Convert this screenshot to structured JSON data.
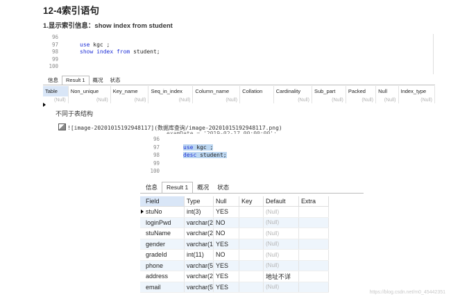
{
  "heading": "12-4索引语句",
  "subheading": "1.显示索引信息：show index from student",
  "editor1": {
    "lines": [
      {
        "n": "96",
        "code": ""
      },
      {
        "n": "97",
        "kw": "use",
        "rest": " kgc ;"
      },
      {
        "n": "98",
        "kw": "show index from",
        "rest": " student;"
      },
      {
        "n": "99",
        "code": ""
      },
      {
        "n": "100",
        "code": ""
      }
    ]
  },
  "tabs1": [
    "信息",
    "Result 1",
    "概况",
    "状态"
  ],
  "grid1": {
    "columns": [
      "Table",
      "Non_unique",
      "Key_name",
      "Seq_in_index",
      "Column_name",
      "Collation",
      "Cardinality",
      "Sub_part",
      "Packed",
      "Null",
      "Index_type"
    ],
    "row": [
      "(Null)",
      "(Null)",
      "(Null)",
      "(Null)",
      "(Null)",
      "",
      "(Null)",
      "(Null)",
      "(Null)",
      "(Null)",
      "(Null)"
    ]
  },
  "note": "不同于表结构",
  "image_line": "![image-20201015192948117](数据库查询/image-20201015192948117.png)",
  "editor2": {
    "top_partial": "examDate = '2019-02-17 00:00:00';",
    "lines": [
      {
        "n": "96",
        "code": ""
      },
      {
        "n": "97",
        "kw": "use",
        "rest": " kgc ;"
      },
      {
        "n": "98",
        "kw": "desc",
        "rest": " student;"
      },
      {
        "n": "99",
        "code": ""
      },
      {
        "n": "100",
        "code": ""
      }
    ]
  },
  "tabs2": [
    "信息",
    "Result 1",
    "概况",
    "状态"
  ],
  "grid2": {
    "columns": [
      "Field",
      "Type",
      "Null",
      "Key",
      "Default",
      "Extra"
    ],
    "rows": [
      [
        "stuNo",
        "int(3)",
        "YES",
        "",
        "(Null)",
        ""
      ],
      [
        "loginPwd",
        "varchar(2",
        "NO",
        "",
        "(Null)",
        ""
      ],
      [
        "stuName",
        "varchar(2",
        "NO",
        "",
        "(Null)",
        ""
      ],
      [
        "gender",
        "varchar(1",
        "YES",
        "",
        "(Null)",
        ""
      ],
      [
        "gradeId",
        "int(11)",
        "NO",
        "",
        "(Null)",
        ""
      ],
      [
        "phone",
        "varchar(5",
        "YES",
        "",
        "(Null)",
        ""
      ],
      [
        "address",
        "varchar(2",
        "YES",
        "",
        "地址不详",
        ""
      ],
      [
        "email",
        "varchar(5",
        "YES",
        "",
        "(Null)",
        ""
      ]
    ]
  },
  "watermark": "https://blog.csdn.net/m0_45442351"
}
